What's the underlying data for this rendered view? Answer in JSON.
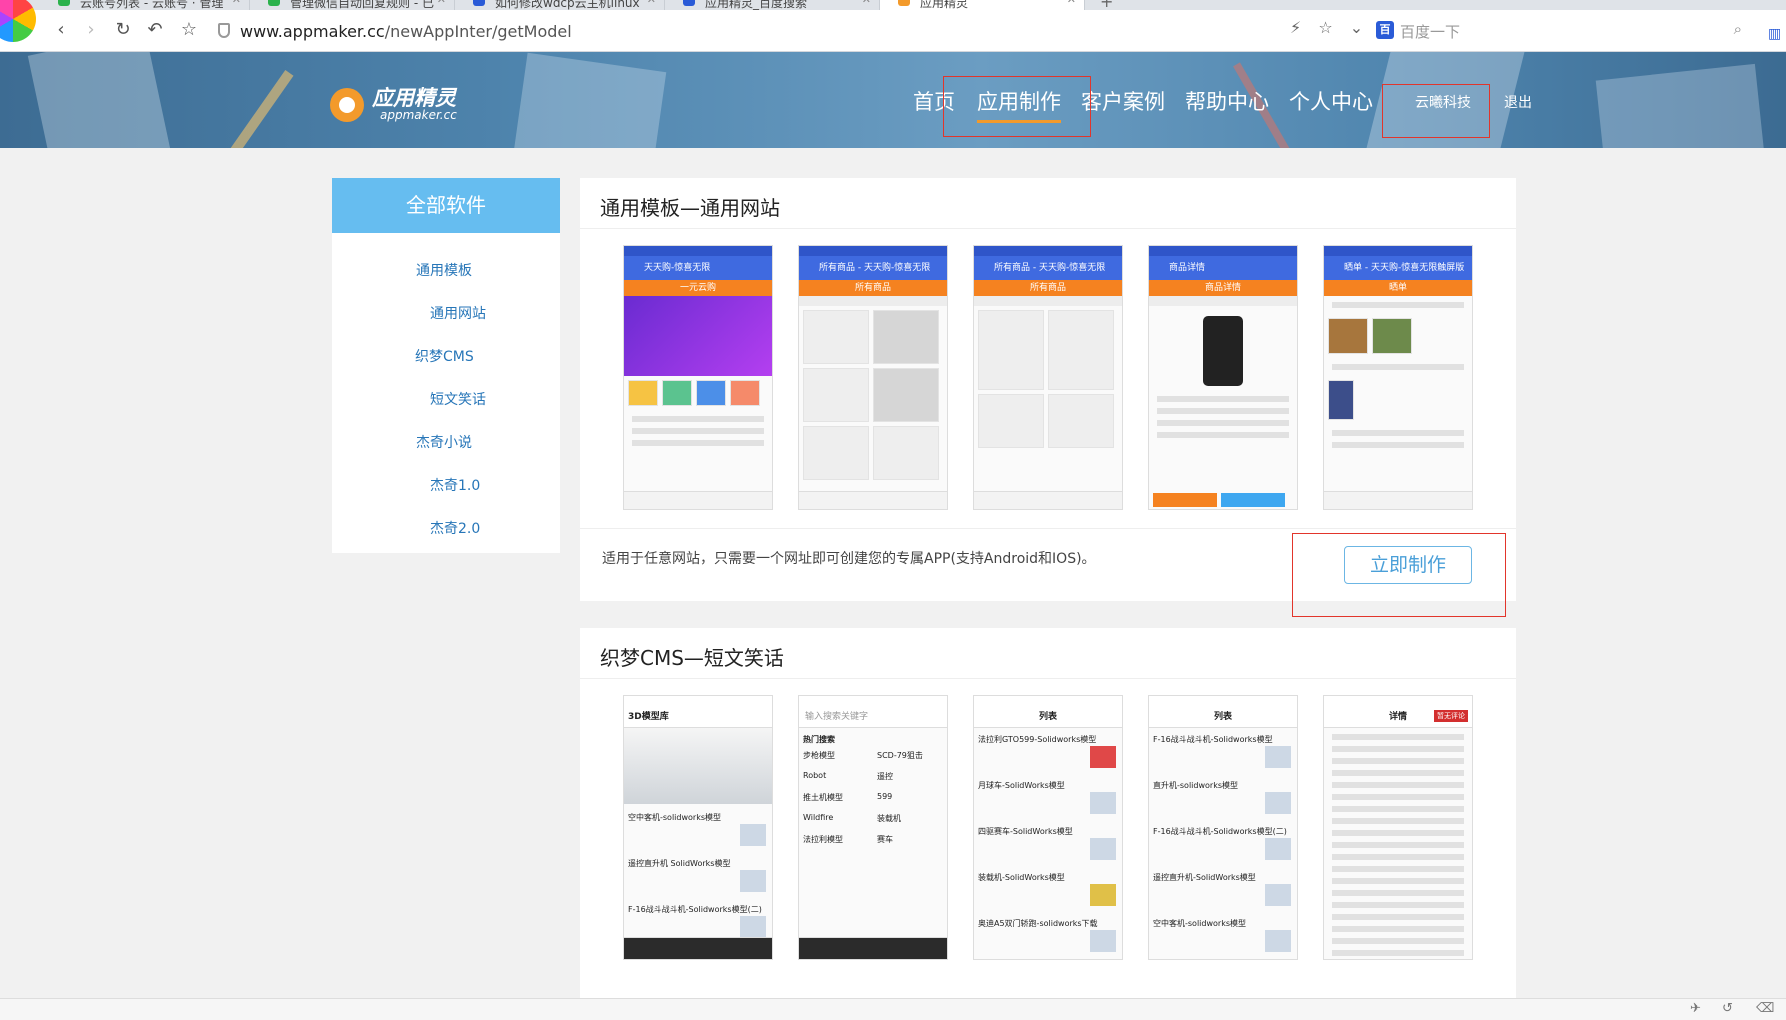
{
  "browser": {
    "tabs": [
      {
        "label": "云账号列表 - 云账号 · 管理"
      },
      {
        "label": "管理微信自动回复规则 - 已"
      },
      {
        "label": "如何修改wdcp云主机linux"
      },
      {
        "label": "应用精灵_百度搜索"
      },
      {
        "label": "应用精灵"
      }
    ],
    "new_tab_label": "+",
    "url_host": "www.appmaker.cc",
    "url_path": "/newAppInter/getModel",
    "search_placeholder": "百度一下",
    "search_engine_badge": "百"
  },
  "site": {
    "brand_name": "应用精灵",
    "brand_domain": "appmaker.cc",
    "nav": [
      {
        "label": "首页"
      },
      {
        "label": "应用制作"
      },
      {
        "label": "客户案例"
      },
      {
        "label": "帮助中心"
      },
      {
        "label": "个人中心"
      }
    ],
    "user_name": "云曦科技",
    "logout_label": "退出",
    "accent_color": "#f39a2b",
    "highlight_color": "#e2352b"
  },
  "sidebar": {
    "title": "全部软件",
    "items": [
      {
        "label": "通用模板"
      },
      {
        "label": "通用网站"
      },
      {
        "label": "织梦CMS"
      },
      {
        "label": "短文笑话"
      },
      {
        "label": "杰奇小说"
      },
      {
        "label": "杰奇1.0"
      },
      {
        "label": "杰奇2.0"
      }
    ]
  },
  "cards": [
    {
      "title": "通用模板—通用网站",
      "description": "适用于任意网站，只需要一个网址即可创建您的专属APP(支持Android和IOS)。",
      "button_label": "立即制作",
      "screens": [
        {
          "header": "天天购-惊喜无限",
          "sub": "一元云购"
        },
        {
          "header": "所有商品 - 天天购-惊喜无限",
          "sub": "所有商品"
        },
        {
          "header": "所有商品 - 天天购-惊喜无限",
          "sub": "所有商品"
        },
        {
          "header": "商品详情",
          "sub": "商品详情"
        },
        {
          "header": "晒单 - 天天购-惊喜无限触屏版",
          "sub": "晒单"
        }
      ]
    },
    {
      "title": "织梦CMS—短文笑话",
      "screens": [
        {
          "header": "3D模型库",
          "items": [
            "空中客机-solidworks模型",
            "遥控直升机 SolidWorks模型",
            "F-16战斗战斗机-Solidworks模型(二)"
          ]
        },
        {
          "header": "输入搜索关键字",
          "items": [
            "热门搜索",
            "步枪模型",
            "SCD-79狙击",
            "Robot",
            "遥控",
            "推土机模型",
            "599",
            "Wildfire",
            "装载机",
            "法拉利模型",
            "赛车"
          ]
        },
        {
          "header": "列表",
          "items": [
            "法拉利GTO599-Solidworks模型",
            "月球车-SolidWorks模型",
            "四驱赛车-SolidWorks模型",
            "装载机-SolidWorks模型",
            "奥迪A5双门轿跑-solidworks下载"
          ]
        },
        {
          "header": "列表",
          "items": [
            "F-16战斗战斗机-Solidworks模型",
            "直升机-solidworks模型",
            "F-16战斗战斗机-Solidworks模型(二)",
            "遥控直升机-SolidWorks模型",
            "空中客机-solidworks模型"
          ]
        },
        {
          "header": "详情",
          "items": [
            "暂无评论"
          ]
        }
      ]
    }
  ]
}
